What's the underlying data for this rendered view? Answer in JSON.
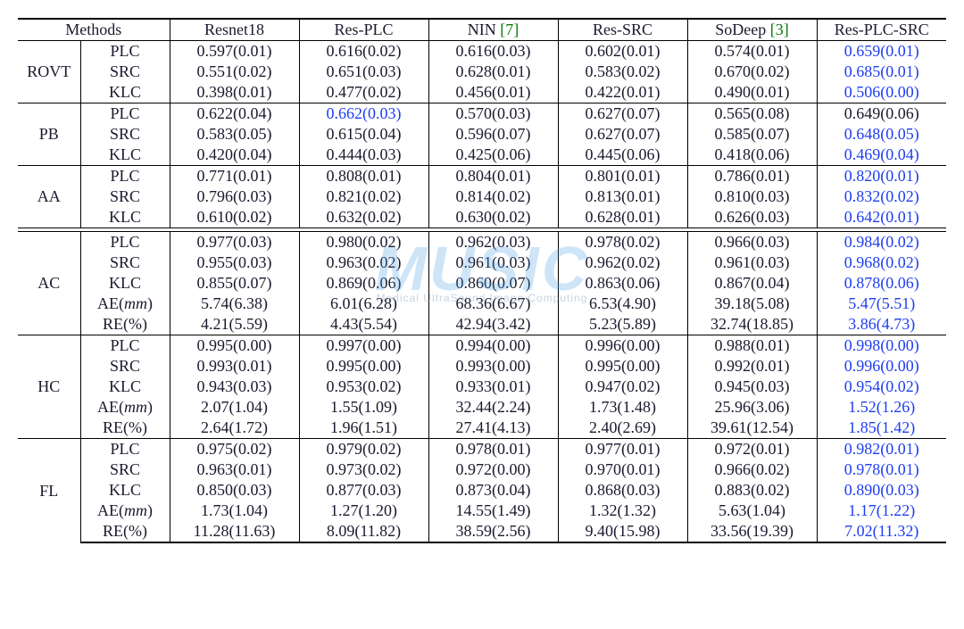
{
  "watermark": {
    "main": "MUSIC",
    "sub": "Medical UltraSound Image Computing"
  },
  "header": {
    "methods": "Methods",
    "cols": [
      "Resnet18",
      "Res-PLC",
      "NIN",
      "Res-SRC",
      "SoDeep",
      "Res-PLC-SRC"
    ],
    "citations": {
      "NIN": "[7]",
      "SoDeep": "[3]"
    }
  },
  "chart_data": {
    "type": "table",
    "columns": [
      "Resnet18",
      "Res-PLC",
      "NIN",
      "Res-SRC",
      "SoDeep",
      "Res-PLC-SRC"
    ],
    "groups": [
      {
        "name": "ROVT",
        "rows": [
          {
            "metric": "PLC",
            "values": [
              "0.597(0.01)",
              "0.616(0.02)",
              "0.616(0.03)",
              "0.602(0.01)",
              "0.574(0.01)",
              "0.659(0.01)"
            ],
            "hl": [
              5
            ]
          },
          {
            "metric": "SRC",
            "values": [
              "0.551(0.02)",
              "0.651(0.03)",
              "0.628(0.01)",
              "0.583(0.02)",
              "0.670(0.02)",
              "0.685(0.01)"
            ],
            "hl": [
              5
            ]
          },
          {
            "metric": "KLC",
            "values": [
              "0.398(0.01)",
              "0.477(0.02)",
              "0.456(0.01)",
              "0.422(0.01)",
              "0.490(0.01)",
              "0.506(0.00)"
            ],
            "hl": [
              5
            ]
          }
        ]
      },
      {
        "name": "PB",
        "rows": [
          {
            "metric": "PLC",
            "values": [
              "0.622(0.04)",
              "0.662(0.03)",
              "0.570(0.03)",
              "0.627(0.07)",
              "0.565(0.08)",
              "0.649(0.06)"
            ],
            "hl": [
              1
            ]
          },
          {
            "metric": "SRC",
            "values": [
              "0.583(0.05)",
              "0.615(0.04)",
              "0.596(0.07)",
              "0.627(0.07)",
              "0.585(0.07)",
              "0.648(0.05)"
            ],
            "hl": [
              5
            ]
          },
          {
            "metric": "KLC",
            "values": [
              "0.420(0.04)",
              "0.444(0.03)",
              "0.425(0.06)",
              "0.445(0.06)",
              "0.418(0.06)",
              "0.469(0.04)"
            ],
            "hl": [
              5
            ]
          }
        ]
      },
      {
        "name": "AA",
        "rows": [
          {
            "metric": "PLC",
            "values": [
              "0.771(0.01)",
              "0.808(0.01)",
              "0.804(0.01)",
              "0.801(0.01)",
              "0.786(0.01)",
              "0.820(0.01)"
            ],
            "hl": [
              5
            ]
          },
          {
            "metric": "SRC",
            "values": [
              "0.796(0.03)",
              "0.821(0.02)",
              "0.814(0.02)",
              "0.813(0.01)",
              "0.810(0.03)",
              "0.832(0.02)"
            ],
            "hl": [
              5
            ]
          },
          {
            "metric": "KLC",
            "values": [
              "0.610(0.02)",
              "0.632(0.02)",
              "0.630(0.02)",
              "0.628(0.01)",
              "0.626(0.03)",
              "0.642(0.01)"
            ],
            "hl": [
              5
            ]
          }
        ]
      },
      {
        "name": "AC",
        "rows": [
          {
            "metric": "PLC",
            "values": [
              "0.977(0.03)",
              "0.980(0.02)",
              "0.962(0.03)",
              "0.978(0.02)",
              "0.966(0.03)",
              "0.984(0.02)"
            ],
            "hl": [
              5
            ]
          },
          {
            "metric": "SRC",
            "values": [
              "0.955(0.03)",
              "0.963(0.02)",
              "0.961(0.03)",
              "0.962(0.02)",
              "0.961(0.03)",
              "0.968(0.02)"
            ],
            "hl": [
              5
            ]
          },
          {
            "metric": "KLC",
            "values": [
              "0.855(0.07)",
              "0.869(0.06)",
              "0.860(0.07)",
              "0.863(0.06)",
              "0.867(0.04)",
              "0.878(0.06)"
            ],
            "hl": [
              5
            ]
          },
          {
            "metric": "AE(mm)",
            "metric_it": "mm",
            "values": [
              "5.74(6.38)",
              "6.01(6.28)",
              "68.36(6.67)",
              "6.53(4.90)",
              "39.18(5.08)",
              "5.47(5.51)"
            ],
            "hl": [
              5
            ]
          },
          {
            "metric": "RE(%)",
            "values": [
              "4.21(5.59)",
              "4.43(5.54)",
              "42.94(3.42)",
              "5.23(5.89)",
              "32.74(18.85)",
              "3.86(4.73)"
            ],
            "hl": [
              5
            ]
          }
        ],
        "double_rule": true
      },
      {
        "name": "HC",
        "rows": [
          {
            "metric": "PLC",
            "values": [
              "0.995(0.00)",
              "0.997(0.00)",
              "0.994(0.00)",
              "0.996(0.00)",
              "0.988(0.01)",
              "0.998(0.00)"
            ],
            "hl": [
              5
            ]
          },
          {
            "metric": "SRC",
            "values": [
              "0.993(0.01)",
              "0.995(0.00)",
              "0.993(0.00)",
              "0.995(0.00)",
              "0.992(0.01)",
              "0.996(0.00)"
            ],
            "hl": [
              5
            ]
          },
          {
            "metric": "KLC",
            "values": [
              "0.943(0.03)",
              "0.953(0.02)",
              "0.933(0.01)",
              "0.947(0.02)",
              "0.945(0.03)",
              "0.954(0.02)"
            ],
            "hl": [
              5
            ]
          },
          {
            "metric": "AE(mm)",
            "metric_it": "mm",
            "values": [
              "2.07(1.04)",
              "1.55(1.09)",
              "32.44(2.24)",
              "1.73(1.48)",
              "25.96(3.06)",
              "1.52(1.26)"
            ],
            "hl": [
              5
            ]
          },
          {
            "metric": "RE(%)",
            "values": [
              "2.64(1.72)",
              "1.96(1.51)",
              "27.41(4.13)",
              "2.40(2.69)",
              "39.61(12.54)",
              "1.85(1.42)"
            ],
            "hl": [
              5
            ]
          }
        ]
      },
      {
        "name": "FL",
        "rows": [
          {
            "metric": "PLC",
            "values": [
              "0.975(0.02)",
              "0.979(0.02)",
              "0.978(0.01)",
              "0.977(0.01)",
              "0.972(0.01)",
              "0.982(0.01)"
            ],
            "hl": [
              5
            ]
          },
          {
            "metric": "SRC",
            "values": [
              "0.963(0.01)",
              "0.973(0.02)",
              "0.972(0.00)",
              "0.970(0.01)",
              "0.966(0.02)",
              "0.978(0.01)"
            ],
            "hl": [
              5
            ]
          },
          {
            "metric": "KLC",
            "values": [
              "0.850(0.03)",
              "0.877(0.03)",
              "0.873(0.04)",
              "0.868(0.03)",
              "0.883(0.02)",
              "0.890(0.03)"
            ],
            "hl": [
              5
            ]
          },
          {
            "metric": "AE(mm)",
            "metric_it": "mm",
            "values": [
              "1.73(1.04)",
              "1.27(1.20)",
              "14.55(1.49)",
              "1.32(1.32)",
              "5.63(1.04)",
              "1.17(1.22)"
            ],
            "hl": [
              5
            ]
          },
          {
            "metric": "RE(%)",
            "values": [
              "11.28(11.63)",
              "8.09(11.82)",
              "38.59(2.56)",
              "9.40(15.98)",
              "33.56(19.39)",
              "7.02(11.32)"
            ],
            "hl": [
              5
            ]
          }
        ]
      }
    ]
  }
}
